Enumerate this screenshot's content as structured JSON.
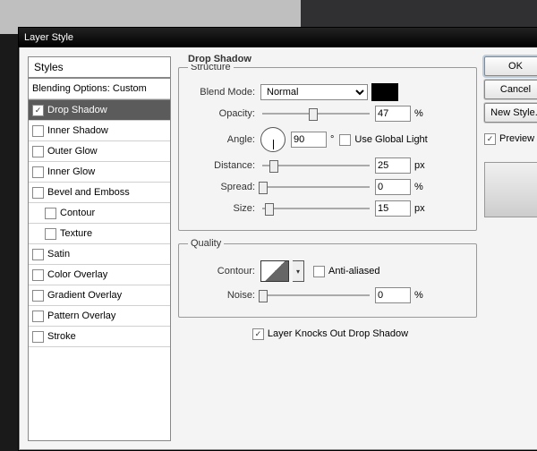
{
  "window": {
    "title": "Layer Style"
  },
  "styles": {
    "header": "Styles",
    "blending": "Blending Options: Custom",
    "items": [
      {
        "label": "Drop Shadow",
        "checked": true,
        "selected": true
      },
      {
        "label": "Inner Shadow",
        "checked": false
      },
      {
        "label": "Outer Glow",
        "checked": false
      },
      {
        "label": "Inner Glow",
        "checked": false
      },
      {
        "label": "Bevel and Emboss",
        "checked": false
      },
      {
        "label": "Contour",
        "checked": false,
        "indent": true
      },
      {
        "label": "Texture",
        "checked": false,
        "indent": true
      },
      {
        "label": "Satin",
        "checked": false
      },
      {
        "label": "Color Overlay",
        "checked": false
      },
      {
        "label": "Gradient Overlay",
        "checked": false
      },
      {
        "label": "Pattern Overlay",
        "checked": false
      },
      {
        "label": "Stroke",
        "checked": false
      }
    ]
  },
  "panel": {
    "title": "Drop Shadow",
    "structure": {
      "legend": "Structure",
      "blend_mode_label": "Blend Mode:",
      "blend_mode_value": "Normal",
      "color": "#000000",
      "opacity_label": "Opacity:",
      "opacity_value": "47",
      "opacity_unit": "%",
      "angle_label": "Angle:",
      "angle_value": "90",
      "angle_unit": "°",
      "global_light_label": "Use Global Light",
      "global_light_checked": false,
      "distance_label": "Distance:",
      "distance_value": "25",
      "distance_unit": "px",
      "spread_label": "Spread:",
      "spread_value": "0",
      "spread_unit": "%",
      "size_label": "Size:",
      "size_value": "15",
      "size_unit": "px"
    },
    "quality": {
      "legend": "Quality",
      "contour_label": "Contour:",
      "aa_label": "Anti-aliased",
      "aa_checked": false,
      "noise_label": "Noise:",
      "noise_value": "0",
      "noise_unit": "%"
    },
    "knockout": {
      "label": "Layer Knocks Out Drop Shadow",
      "checked": true
    }
  },
  "buttons": {
    "ok": "OK",
    "cancel": "Cancel",
    "new_style": "New Style..",
    "preview_label": "Preview",
    "preview_checked": true
  }
}
